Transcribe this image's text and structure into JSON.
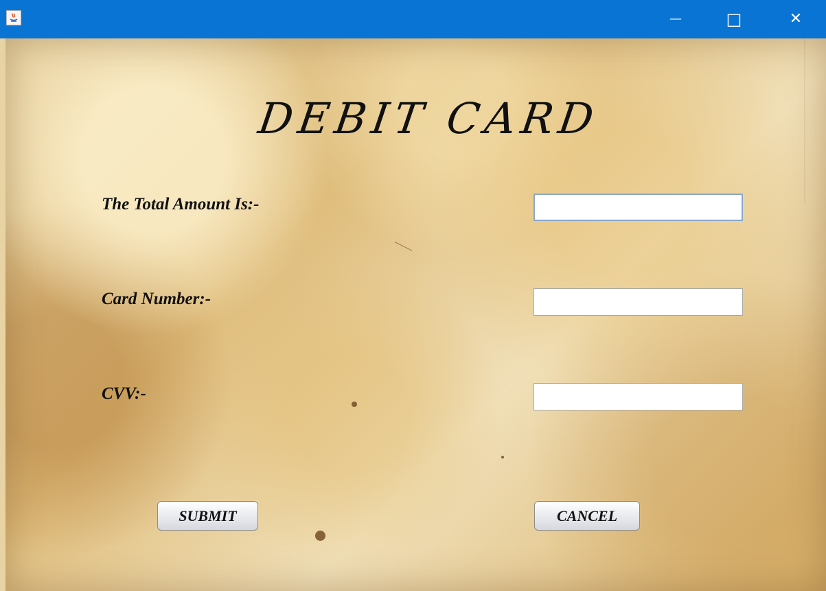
{
  "window": {
    "minimize_glyph": "—",
    "maximize_glyph": "□",
    "close_glyph": "✕"
  },
  "heading": "DEBIT CARD",
  "form": {
    "total_amount_label": "The Total Amount Is:-",
    "total_amount_value": "",
    "card_number_label": "Card Number:-",
    "card_number_value": "",
    "cvv_label": "CVV:-",
    "cvv_value": ""
  },
  "buttons": {
    "submit": "SUBMIT",
    "cancel": "CANCEL"
  },
  "colors": {
    "titlebar": "#0a74d4",
    "paper": "#e8d3a4",
    "text": "#111111",
    "field_focus_border": "#8ba6ca"
  },
  "icons": {
    "app": "java-icon",
    "minimize": "minimize-icon",
    "maximize": "maximize-icon",
    "close": "close-icon"
  }
}
